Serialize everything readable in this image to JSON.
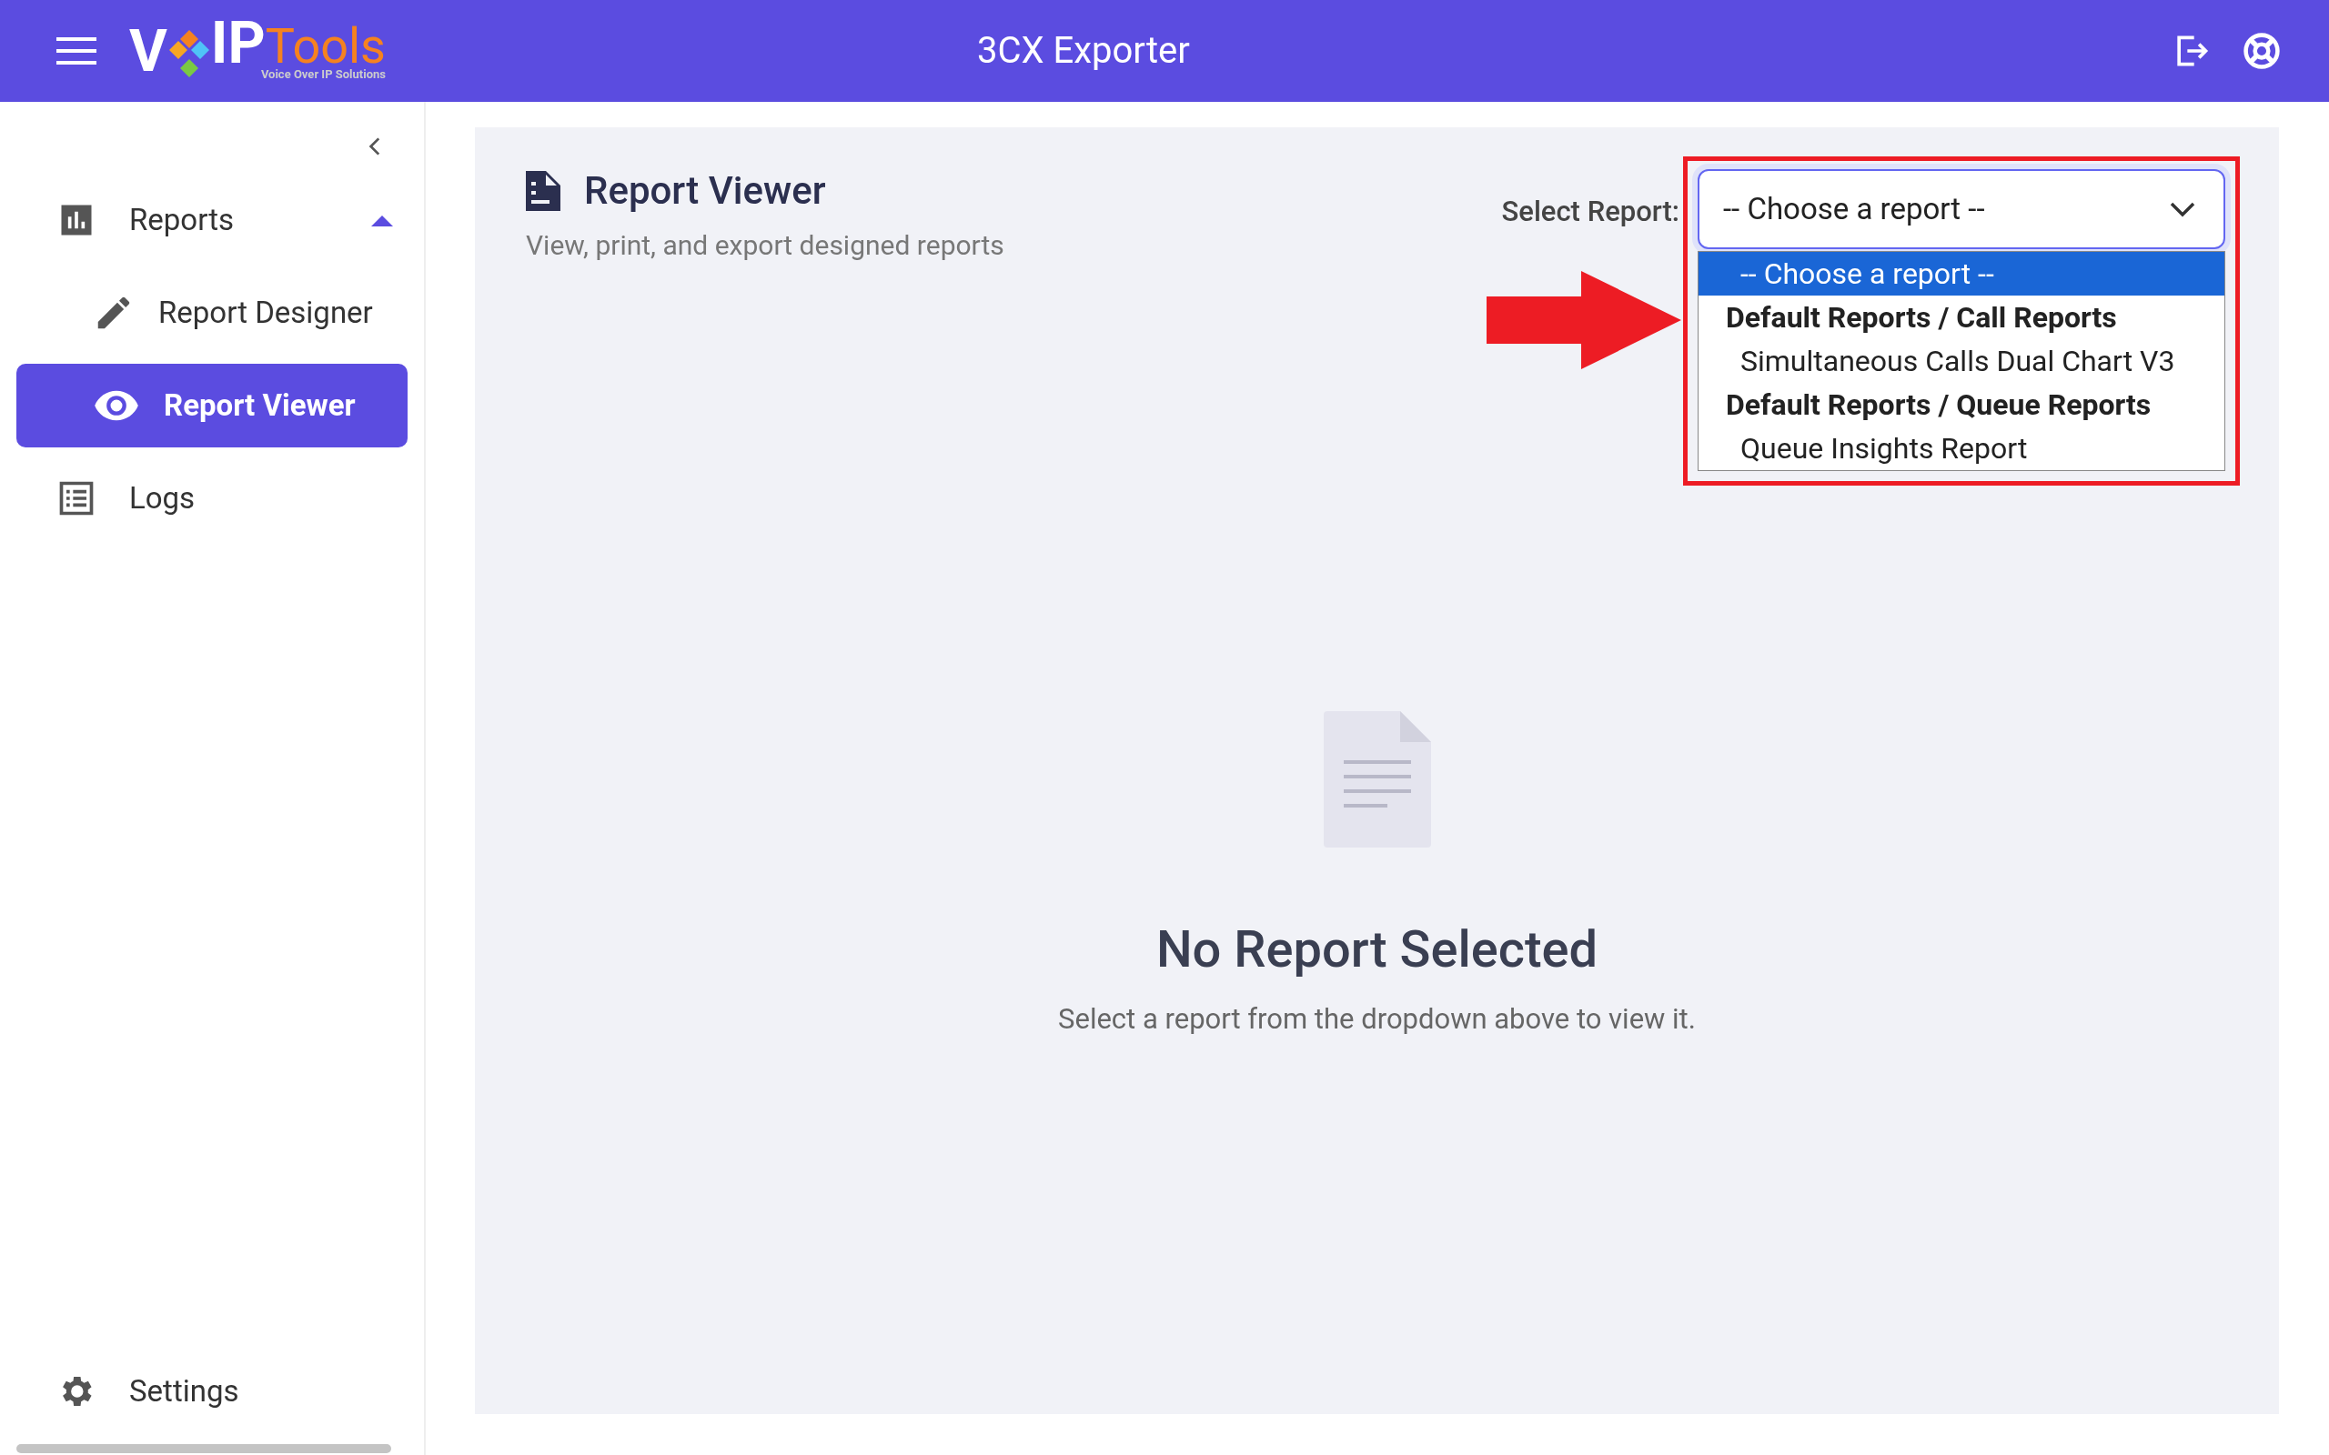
{
  "header": {
    "logo": {
      "letter_left": "V",
      "letters_mid": "IP",
      "letters_right": "Tools",
      "tagline": "Voice Over IP Solutions"
    },
    "title": "3CX Exporter"
  },
  "sidebar": {
    "items": [
      {
        "label": "Reports",
        "kind": "group",
        "selected": false,
        "expanded": true,
        "children": [
          {
            "label": "Report Designer",
            "kind": "pencil",
            "selected": false
          },
          {
            "label": "Report Viewer",
            "kind": "eye",
            "selected": true
          }
        ]
      },
      {
        "label": "Logs",
        "kind": "list",
        "selected": false
      }
    ],
    "footer_item": {
      "label": "Settings"
    }
  },
  "page": {
    "title": "Report Viewer",
    "subtitle": "View, print, and export designed reports",
    "select": {
      "label": "Select Report:",
      "value": "-- Choose a report --",
      "expanded": true,
      "options": [
        {
          "kind": "option",
          "label": "-- Choose a report --",
          "selected": true
        },
        {
          "kind": "group",
          "label": "Default Reports / Call Reports",
          "selected": false
        },
        {
          "kind": "option",
          "label": "Simultaneous Calls Dual Chart V3",
          "selected": false
        },
        {
          "kind": "group",
          "label": "Default Reports / Queue Reports",
          "selected": false
        },
        {
          "kind": "option",
          "label": "Queue Insights Report",
          "selected": false
        }
      ]
    },
    "empty_state": {
      "title": "No Report Selected",
      "message": "Select a report from the dropdown above to view it."
    }
  }
}
